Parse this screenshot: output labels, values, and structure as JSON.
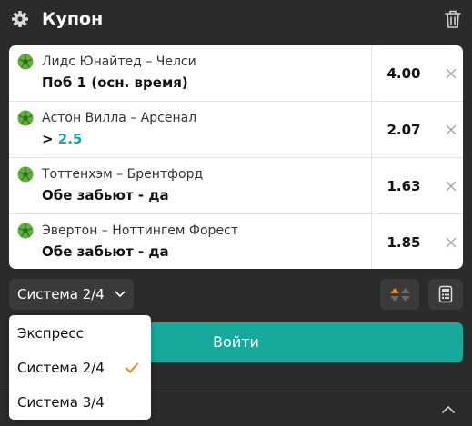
{
  "header": {
    "title": "Купон",
    "settings_icon": "gear-icon",
    "delete_icon": "trash-icon"
  },
  "bets": [
    {
      "match": "Лидс Юнайтед – Челси",
      "market": "Поб 1 (осн. время)",
      "market_prefix": "",
      "market_accent": "",
      "odds": "4.00"
    },
    {
      "match": "Астон Вилла – Арсенал",
      "market": "",
      "market_prefix": "> ",
      "market_accent": "2.5",
      "odds": "2.07"
    },
    {
      "match": "Тоттенхэм – Брентфорд",
      "market": "Обе забьют - да",
      "market_prefix": "",
      "market_accent": "",
      "odds": "1.63"
    },
    {
      "match": "Эвертон – Ноттингем Форест",
      "market": "Обе забьют - да",
      "market_prefix": "",
      "market_accent": "",
      "odds": "1.85"
    }
  ],
  "bet_type": {
    "selected": "Система 2/4",
    "options": [
      "Экспресс",
      "Система 2/4",
      "Система 3/4"
    ],
    "selected_index": 1
  },
  "actions": {
    "login_label": "Войти"
  },
  "colors": {
    "panel": "#2b2b2b",
    "accent": "#16a99c",
    "odds_up": "#e8891c",
    "check": "#e8891c",
    "sport_ball": "#5fae3a"
  }
}
